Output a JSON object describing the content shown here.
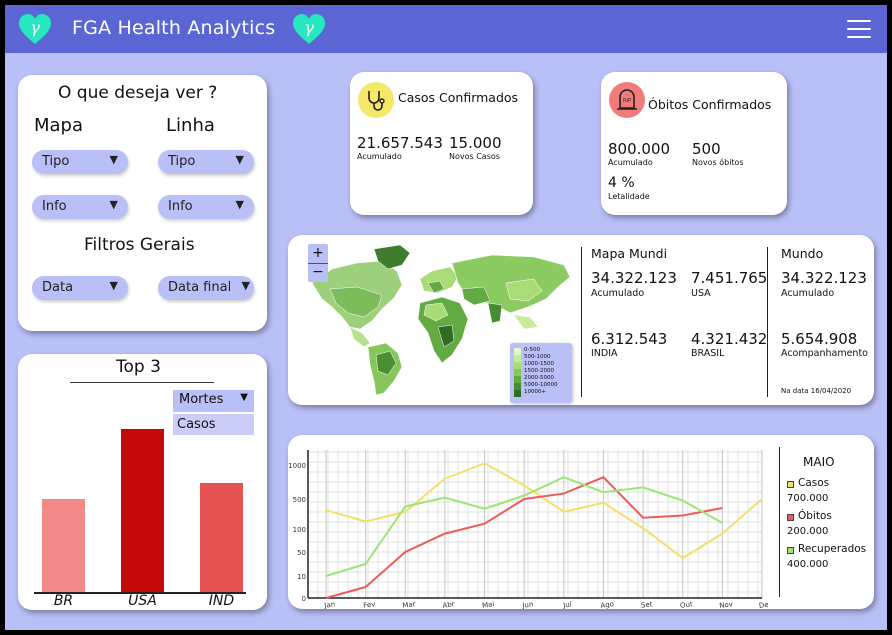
{
  "header": {
    "title": "FGA Health Analytics",
    "logo_glyph": "γ",
    "logo_color": "#25e8c0",
    "bg": "#5b66d4",
    "menu_icon": "hamburger-icon"
  },
  "filters": {
    "title": "O que deseja ver ?",
    "map_heading": "Mapa",
    "line_heading": "Linha",
    "map_type": "Tipo",
    "map_info": "Info",
    "line_type": "Tipo",
    "line_info": "Info",
    "general_heading": "Filtros Gerais",
    "date": "Data",
    "end_date": "Data final"
  },
  "cases": {
    "title": "Casos Confirmados",
    "icon": "stethoscope-icon",
    "icon_bg": "#f5e76a",
    "total": "21.657.543",
    "total_label": "Acumulado",
    "new": "15.000",
    "new_label": "Novos Casos"
  },
  "deaths": {
    "title": "Óbitos Confirmados",
    "icon": "tombstone-icon",
    "icon_bg": "#ef7b7b",
    "total": "800.000",
    "total_label": "Acumulado",
    "new": "500",
    "new_label": "Novos óbitos",
    "lethality": "4 %",
    "lethality_label": "Letalidade"
  },
  "map_panel": {
    "zoom_in": "+",
    "zoom_out": "−",
    "legend": [
      "0-500",
      "500-1000",
      "1000-1500",
      "1500-2000",
      "2000-5000",
      "5000-10000",
      "10000+"
    ],
    "legend_colors": [
      "#e6f5c9",
      "#c8eb9c",
      "#a9dc76",
      "#86c65a",
      "#63a944",
      "#478c33",
      "#2f6b22"
    ],
    "section_title": "Mapa Mundi",
    "stats": [
      {
        "value": "34.322.123",
        "label": "Acumulado"
      },
      {
        "value": "7.451.765",
        "label": "USA"
      },
      {
        "value": "6.312.543",
        "label": "INDIA"
      },
      {
        "value": "4.321.432",
        "label": "BRASIL"
      }
    ],
    "world_title": "Mundo",
    "world_total": "34.322.123",
    "world_total_label": "Acumulado",
    "world_follow": "5.654.908",
    "world_follow_label": "Acompanhamento",
    "date_note": "Na data 16/04/2020"
  },
  "top3": {
    "title": "Top 3",
    "option_selected": "Mortes",
    "option_other": "Casos",
    "bars": [
      {
        "label": "BR",
        "value": 0.57,
        "color": "#f28a8a"
      },
      {
        "label": "USA",
        "value": 1.0,
        "color": "#c20808"
      },
      {
        "label": "IND",
        "value": 0.67,
        "color": "#e55252"
      }
    ]
  },
  "line_chart": {
    "legend_title": "MAIO",
    "series_cases": "Casos",
    "value_cases": "700.000",
    "series_deaths": "Óbitos",
    "value_deaths": "200.000",
    "series_recovered": "Recuperados",
    "value_recovered": "400.000",
    "chart_data": {
      "type": "line",
      "x": [
        "Jan",
        "Fev",
        "Mar",
        "Abr",
        "Mai",
        "Jun",
        "Jul",
        "Ago",
        "Set",
        "Out",
        "Nov",
        "Dec"
      ],
      "yticks": [
        "1000",
        "500",
        "100",
        "50",
        "10",
        "0"
      ],
      "series": [
        {
          "name": "Casos",
          "color": "#f3e06a",
          "values": [
            350,
            200,
            330,
            800,
            1050,
            700,
            330,
            450,
            110,
            40,
            90,
            500
          ]
        },
        {
          "name": "Óbitos",
          "color": "#ec5a5a",
          "values": [
            0,
            5,
            50,
            90,
            170,
            500,
            580,
            820,
            250,
            280,
            380
          ]
        },
        {
          "name": "Recuperados",
          "color": "#9ce574",
          "values": [
            10,
            30,
            400,
            520,
            370,
            550,
            820,
            600,
            670,
            480,
            180
          ]
        }
      ]
    }
  }
}
